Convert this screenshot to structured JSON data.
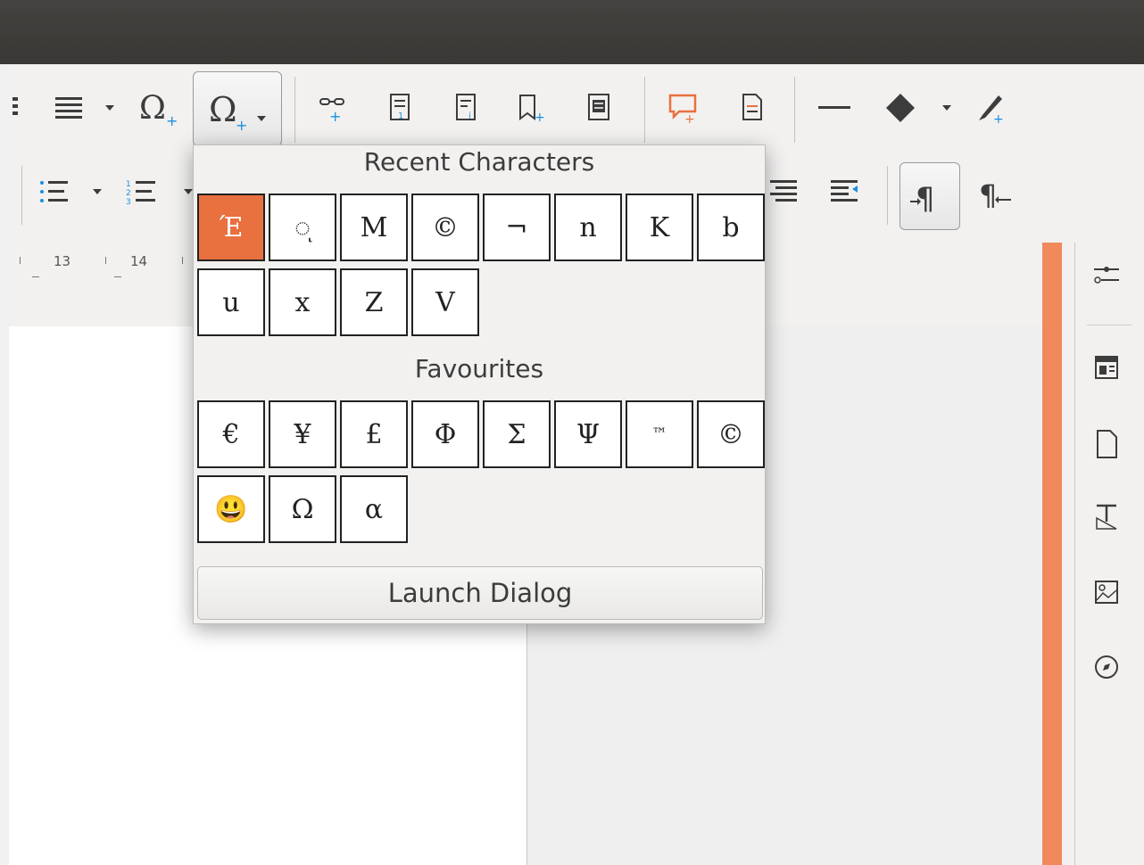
{
  "ruler": {
    "numbers": [
      "13",
      "14"
    ]
  },
  "toolbar": {
    "icons": [
      "paragraph-align-icon",
      "special-character-icon",
      "special-character-dropdown-icon",
      "cross-reference-icon",
      "footnote-icon",
      "endnote-icon",
      "bookmark-icon",
      "insert-field-icon",
      "comment-icon",
      "track-changes-icon",
      "line-icon",
      "shape-icon",
      "draw-icon"
    ]
  },
  "popup": {
    "recent_title": "Recent Characters",
    "recent_chars": [
      "Έ",
      "◌ͅ",
      "M",
      "©",
      "¬",
      "n",
      "K",
      "b",
      "u",
      "x",
      "Z",
      "V"
    ],
    "favourites_title": "Favourites",
    "favourite_chars": [
      "€",
      "¥",
      "£",
      "Φ",
      "Σ",
      "Ψ",
      "™",
      "©",
      "😃",
      "Ω",
      "α"
    ],
    "launch_label": "Launch Dialog"
  },
  "colors": {
    "accent": "#e9703f",
    "sidebar_accent": "#f08a5d",
    "titlebar": "#3e3c39"
  }
}
